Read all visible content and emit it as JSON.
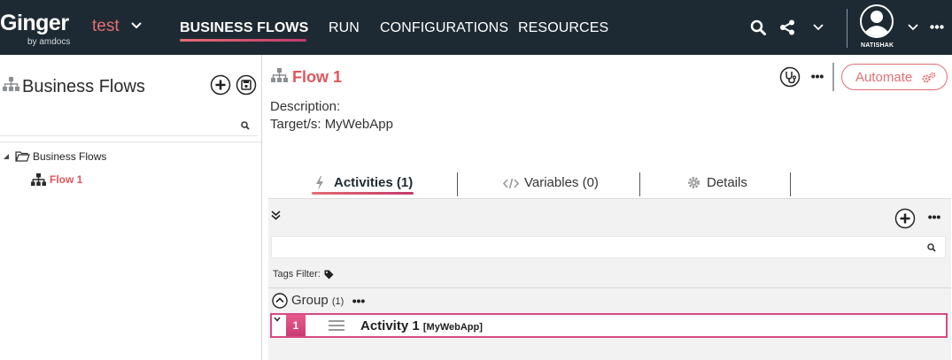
{
  "topbar": {
    "logo": "Ginger",
    "logo_sub": "by amdocs",
    "environment": "test",
    "nav": [
      {
        "label": "BUSINESS FLOWS",
        "active": true
      },
      {
        "label": "RUN",
        "active": false
      },
      {
        "label": "CONFIGURATIONS",
        "active": false
      },
      {
        "label": "RESOURCES",
        "active": false
      }
    ],
    "icons": [
      "search-icon",
      "share-icon",
      "chevron-down-icon",
      "user-avatar-icon",
      "chevron-down-icon",
      "more-icon"
    ],
    "user_name": "NATISHAK"
  },
  "left_panel": {
    "title": "Business Flows",
    "search_placeholder": "",
    "tree": {
      "root": "Business Flows",
      "children": [
        {
          "label": "Flow 1",
          "selected": true
        }
      ]
    }
  },
  "main": {
    "flow_title": "Flow 1",
    "description_label": "Description:",
    "target_label": "Target/s: MyWebApp",
    "automate_label": "Automate",
    "tabs": [
      {
        "label": "Activities (1)",
        "icon": "lightning-icon",
        "active": true
      },
      {
        "label": "Variables (0)",
        "icon": "code-icon",
        "active": false
      },
      {
        "label": "Details",
        "icon": "gear-icon",
        "active": false
      }
    ],
    "activities": {
      "search_placeholder": "",
      "tags_filter_label": "Tags Filter:",
      "group": {
        "label": "Group",
        "count": "(1)"
      },
      "rows": [
        {
          "number": "1",
          "name": "Activity 1",
          "target": "[MyWebApp]"
        }
      ]
    }
  },
  "colors": {
    "topbar_bg": "#1e2a33",
    "accent": "#e46e72",
    "accent_magenta": "#d64a84",
    "selected_text": "#e0565b"
  }
}
